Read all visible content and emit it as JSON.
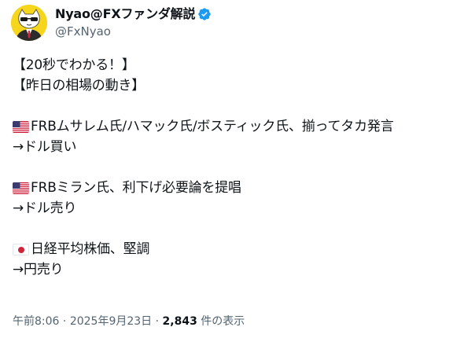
{
  "author": {
    "display_name": "Nyao@FXファンダ解説",
    "handle": "@FxNyao",
    "verified": true,
    "verified_color": "#1d9bf0"
  },
  "tweet": {
    "lines": [
      {
        "text": "【20秒でわかる！】"
      },
      {
        "text": "【昨日の相場の動き】"
      },
      {
        "text": ""
      },
      {
        "flag": "us-flag-icon",
        "text": "FRBムサレム氏/ハマック氏/ボスティック氏、揃ってタカ発言"
      },
      {
        "text": "→ドル買い"
      },
      {
        "text": ""
      },
      {
        "flag": "us-flag-icon",
        "text": "FRBミラン氏、利下げ必要論を提唱"
      },
      {
        "text": "→ドル売り"
      },
      {
        "text": ""
      },
      {
        "flag": "jp-flag-icon",
        "text": "日経平均株価、堅調"
      },
      {
        "text": "→円売り"
      }
    ]
  },
  "meta": {
    "time": "午前8:06",
    "sep1": " · ",
    "date": "2025年9月23日",
    "sep2": " · ",
    "views_count": "2,843",
    "views_label": " 件の表示"
  }
}
